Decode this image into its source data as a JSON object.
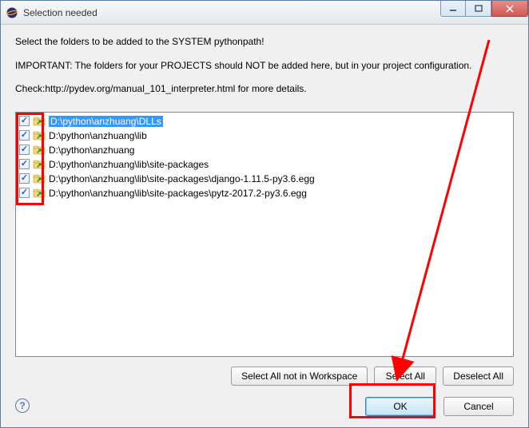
{
  "window": {
    "title": "Selection needed"
  },
  "intro": {
    "line1": "Select the folders to be added to the SYSTEM pythonpath!",
    "line2": "IMPORTANT: The folders for your PROJECTS should NOT be added here, but in your project configuration.",
    "line3": "Check:http://pydev.org/manual_101_interpreter.html for more details."
  },
  "items": [
    {
      "checked": true,
      "path": "D:\\python\\anzhuang\\DLLs",
      "selected": true
    },
    {
      "checked": true,
      "path": "D:\\python\\anzhuang\\lib",
      "selected": false
    },
    {
      "checked": true,
      "path": "D:\\python\\anzhuang",
      "selected": false
    },
    {
      "checked": true,
      "path": "D:\\python\\anzhuang\\lib\\site-packages",
      "selected": false
    },
    {
      "checked": true,
      "path": "D:\\python\\anzhuang\\lib\\site-packages\\django-1.11.5-py3.6.egg",
      "selected": false
    },
    {
      "checked": true,
      "path": "D:\\python\\anzhuang\\lib\\site-packages\\pytz-2017.2-py3.6.egg",
      "selected": false
    }
  ],
  "buttons": {
    "select_not_workspace": "Select All not in Workspace",
    "select_all": "Select All",
    "deselect_all": "Deselect All",
    "ok": "OK",
    "cancel": "Cancel"
  },
  "help_tooltip": "?"
}
